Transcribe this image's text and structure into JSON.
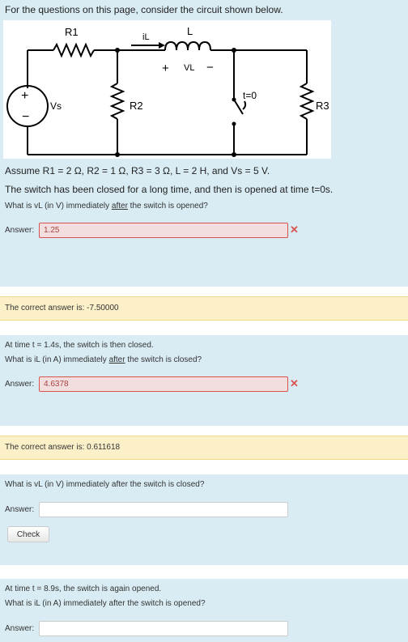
{
  "intro": {
    "text": "For the questions on this page, consider the circuit shown below.",
    "assume": "Assume R1 = 2 Ω, R2 = 1 Ω, R3 = 3 Ω, L = 2 H, and Vs = 5 V.",
    "switch_note": "The switch has been closed for a long time, and then is opened at time t=0s."
  },
  "circuit": {
    "r1": "R1",
    "r2": "R2",
    "r3": "R3",
    "l": "L",
    "il": "iL",
    "plus": "+",
    "vl": "VL",
    "minus": "−",
    "vs": "Vs",
    "switch_time": "t=0"
  },
  "q1": {
    "pre": "What is vL (in V) immediately ",
    "emph": "after",
    "post": " the switch is opened?",
    "answer_label": "Answer:",
    "answer_value": "1.25",
    "correct": "The correct answer is: -7.50000"
  },
  "q2": {
    "time_note": "At time t = 1.4s, the switch is then closed.",
    "pre": "What is iL (in A) immediately ",
    "emph": "after",
    "post": " the switch is closed?",
    "answer_label": "Answer:",
    "answer_value": "4.6378",
    "correct": "The correct answer is: 0.611618"
  },
  "q3": {
    "text": "What is vL (in V) immediately after the switch is closed?",
    "answer_label": "Answer:",
    "answer_value": "",
    "check_label": "Check"
  },
  "q4": {
    "time_note": "At time t = 8.9s, the switch is again opened.",
    "text": "What is iL (in A) immediately after the switch is opened?",
    "answer_label": "Answer:",
    "answer_value": ""
  },
  "colors": {
    "panel_bg": "#d9ecf3",
    "correct_bg": "#fcf0c9",
    "wrong_bg": "#f2dede",
    "wrong_mark": "#d9534f"
  }
}
